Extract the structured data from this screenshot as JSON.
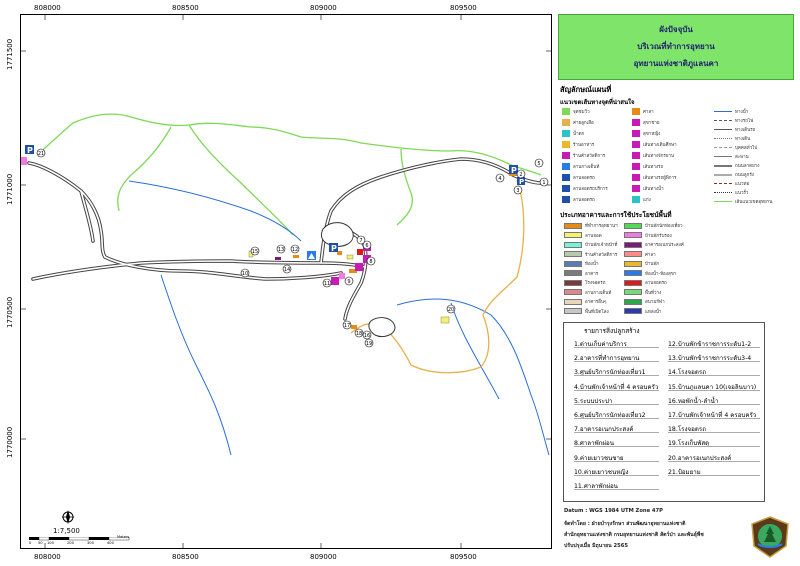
{
  "title": {
    "line1": "ผังปัจจุบัน",
    "line2": "บริเวณที่ทำการอุทยาน",
    "line3": "อุทยานแห่งชาติภูแลนคา"
  },
  "coords": {
    "x": [
      "808000",
      "808500",
      "809000",
      "809500"
    ],
    "y": [
      "1771500",
      "1771000",
      "1770500",
      "1770000"
    ]
  },
  "legend": {
    "heading": "สัญลักษณ์แผนที่",
    "subheading": "แนวเขตเส้นทางจุดที่น่าสนใจ",
    "col1": [
      "จุดชมวิว",
      "ค่ายลูกเสือ",
      "น้ำตก",
      "ร้านอาหาร",
      "ร้านค้าสวัสดิการ",
      "ลานกางเต็นท์",
      "ลานจอดรถ",
      "ลานจอดรถบริการ",
      "ลานจอดรถ"
    ],
    "col2": [
      "ศาลา",
      "สุขาชาย",
      "สุขาหญิง",
      "เส้นทางเดินศึกษา",
      "เส้นทางจักรยาน",
      "เส้นทางรถ",
      "เส้นทางรถผู้พิการ",
      "เส้นทางน้ำ",
      "แก่ง"
    ],
    "col3": [
      "ทางน้ำ",
      "ทางรถไฟ",
      "ทางเดินรถ",
      "ทางเดิน",
      "บุคคลทั่วไป",
      "สะพาน",
      "ถนนลาดยาง",
      "ถนนลูกรัง",
      "แนวท่อ",
      "แนวรั้ว",
      "เส้นแนวเขตอุทยาน"
    ]
  },
  "landuse": {
    "heading": "ประเภทอาคารและการใช้ประโยชน์พื้นที่",
    "col1": [
      "ที่ทำการอุทยานฯ",
      "ลานจอด",
      "บ้านพักเจ้าหน้าที่",
      "ร้านค้าสวัสดิการ",
      "ห้องน้ำ",
      "อาคาร",
      "โรงจอดรถ",
      "ลานกางเต็นท์",
      "อาคารอื่นๆ",
      "พื้นที่เปิดโล่ง"
    ],
    "col2": [
      "บ้านพักนักท่องเที่ยว",
      "บ้านพักรับรอง",
      "อาคารอเนกประสงค์",
      "ศาลา",
      "บ้านพัก",
      "ห้องน้ำ-ห้องสุขา",
      "ลานจอดรถ",
      "พื้นที่ว่าง",
      "สนามกีฬา",
      "แหล่งน้ำ"
    ],
    "colors1": [
      "#e88a1a",
      "#f5f26e",
      "#7df0d8",
      "#b8c9ae",
      "#5b7bb3",
      "#7a7a7a",
      "#7b3a3a",
      "#d98a8a",
      "#e8d6b8",
      "#c7c7c7"
    ],
    "colors2": [
      "#55d955",
      "#f07be0",
      "#7a1a7a",
      "#ff8a8a",
      "#e8b830",
      "#2a7ae8",
      "#e01a1a",
      "#79d979",
      "#2aa84a",
      "#2a3ab0"
    ]
  },
  "buildings": {
    "heading": "รายการสิ่งปลูกสร้าง",
    "left": [
      "1.ด่านเก็บค่าบริการ",
      "2.อาคารที่ทำการอุทยาน",
      "3.ศูนย์บริการนักท่องเที่ยว1",
      "4.บ้านพักเจ้าหน้าที่ 4 ครอบครัว",
      "5.ระบบประปา",
      "6.ศูนย์บริการนักท่องเที่ยว2",
      "7.อาคารอเนกประสงค์",
      "8.ศาลาพักผ่อน",
      "9.ค่ายเยาวชนชาย",
      "10.ค่ายเยาวชนหญิง",
      "11.ศาลาพักผ่อน"
    ],
    "right": [
      "12.บ้านพักข้าราชการระดับ1-2",
      "13.บ้านพักข้าราชการระดับ3-4",
      "14.โรงจอดรถ",
      "15.บ้านภูแลนคา 10(เจอลินบาว)",
      "16.หอพักน้ำ-ลำน้ำ",
      "17.บ้านพักเจ้าหน้าที่ 4 ครอบครัว",
      "18.โรงจอดรถ",
      "19.โรงเก็บพัสดุ",
      "20.อาคารอเนกประสงค์",
      "21.ป้อมยาม"
    ]
  },
  "footer": {
    "datum": "Datum : WGS 1984 UTM Zone 47P",
    "made_by": "จัดทำโดย : ฝ่ายบำรุงรักษา ส่วนพัฒนาอุทยานแห่งชาติ",
    "office": "สำนักอุทยานแห่งชาติ กรมอุทยานแห่งชาติ สัตว์ป่า และพันธุ์พืช",
    "updated": "ปรับปรุงเมื่อ มิถุนายน 2565"
  },
  "scale": {
    "ratio": "1:7,500",
    "ticks": [
      "0",
      "50",
      "100",
      "200",
      "300",
      "400"
    ],
    "unit": "Meters"
  },
  "markers": [
    "1",
    "2",
    "3",
    "4",
    "5",
    "6",
    "7",
    "8",
    "9",
    "10",
    "11",
    "12",
    "13",
    "14",
    "15",
    "16",
    "17",
    "18",
    "19",
    "20",
    "21"
  ],
  "colors": {
    "boundary": "#7ed957",
    "river": "#2a6fd6",
    "trail": "#e8b04a",
    "road_edge": "#444444",
    "road_fill": "#ffffff",
    "title_bg": "#7fe46a"
  }
}
